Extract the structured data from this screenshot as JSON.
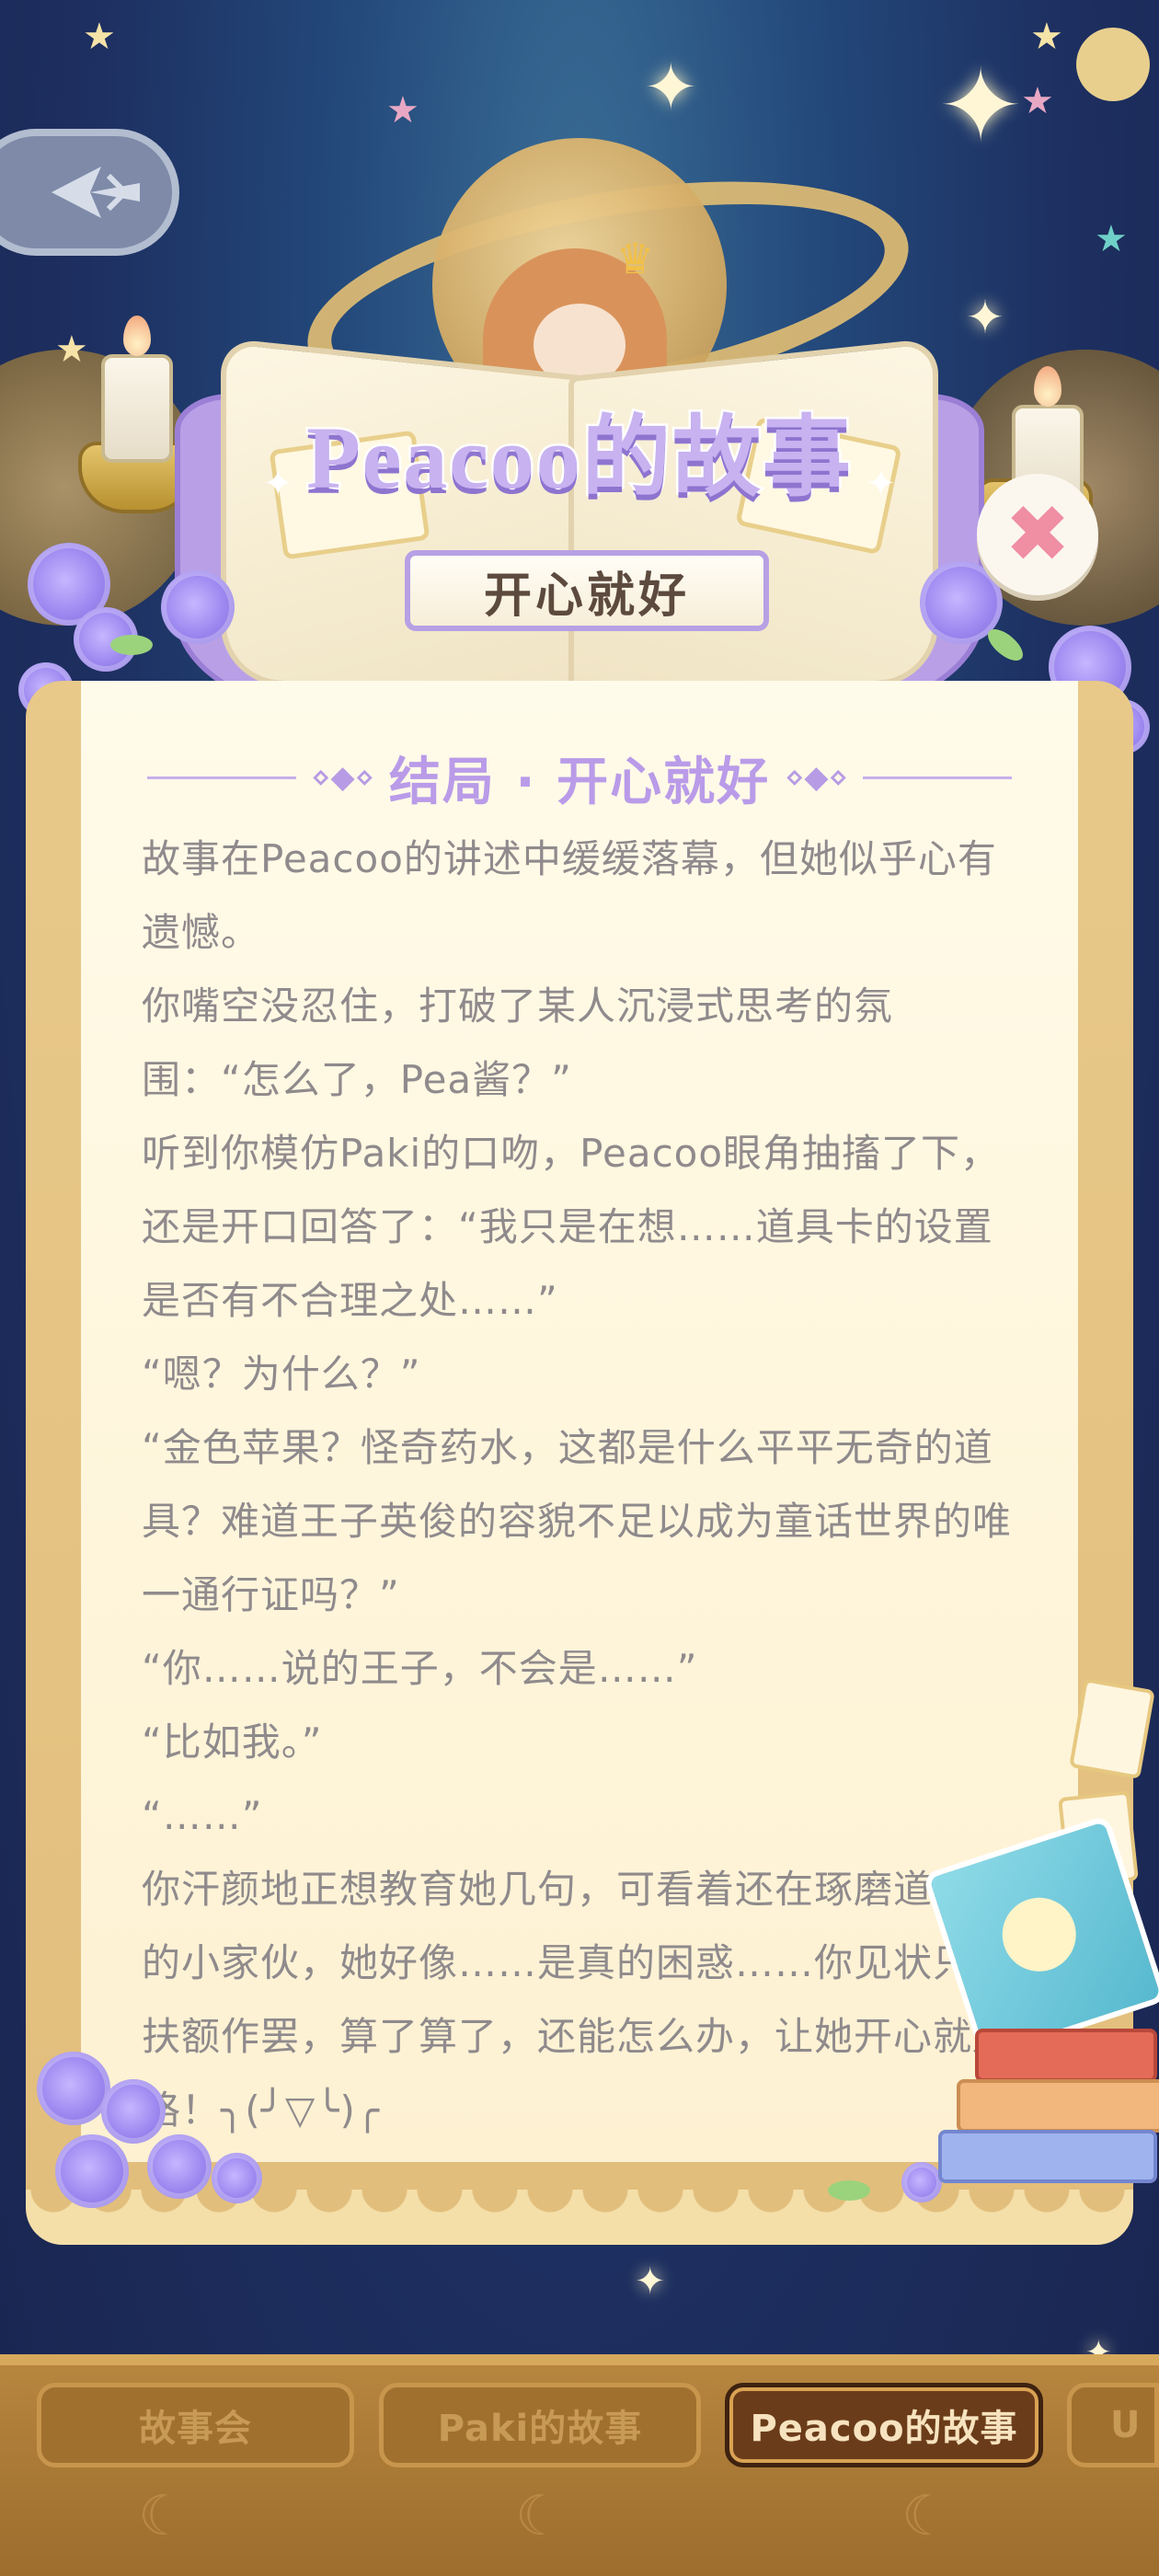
{
  "header": {
    "title": "Peacoo的故事",
    "subtitle": "开心就好"
  },
  "section": {
    "heading": "结局 · 开心就好"
  },
  "story": {
    "paragraphs": [
      "故事在Peacoo的讲述中缓缓落幕，但她似乎心有遗憾。",
      "你嘴空没忍住，打破了某人沉浸式思考的氛围：“怎么了，Pea酱？”",
      "听到你模仿Paki的口吻，Peacoo眼角抽搐了下，还是开口回答了：“我只是在想……道具卡的设置是否有不合理之处……”",
      "“嗯？为什么？”",
      "“金色苹果？怪奇药水，这都是什么平平无奇的道具？难道王子英俊的容貌不足以成为童话世界的唯一通行证吗？”",
      "“你……说的王子，不会是……”",
      "“比如我。”",
      "“……”",
      "你汗颜地正想教育她几句，可看着还在琢磨道具卡的小家伙，她好像……是真的困惑……你见状只能扶额作罢，算了算了，还能怎么办，让她开心就好咯！╮(╯▽╰)╭"
    ]
  },
  "tabs": [
    {
      "label": "故事会",
      "active": false
    },
    {
      "label": "Paki的故事",
      "active": false
    },
    {
      "label": "Peacoo的故事",
      "active": true
    },
    {
      "label": "U",
      "active": false
    }
  ],
  "icons": {
    "back": "back-arrow-icon",
    "close": "close-icon"
  },
  "colors": {
    "accent": "#b99be8",
    "close": "#f08ea3",
    "text": "#8f8a8c",
    "tab_active": "#6b3c1a"
  }
}
